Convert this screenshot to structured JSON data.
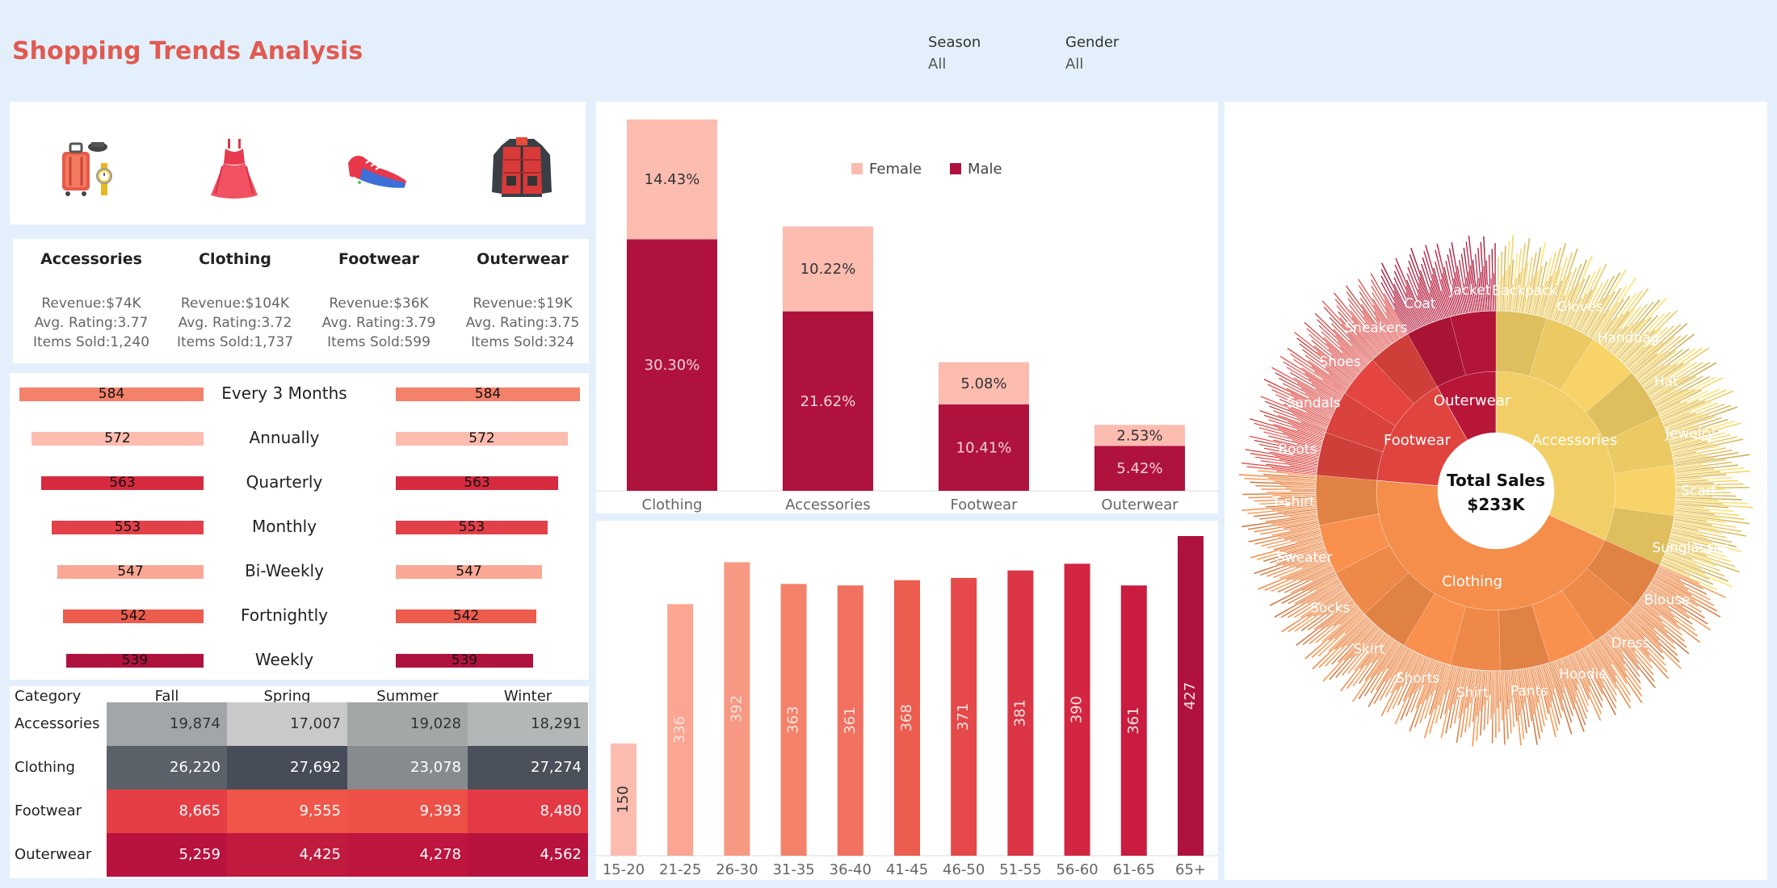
{
  "header": {
    "title": "Shopping Trends Analysis",
    "filters": [
      {
        "label": "Season",
        "value": "All"
      },
      {
        "label": "Gender",
        "value": "All"
      }
    ]
  },
  "icons": [
    "luggage-watch-icon",
    "dress-icon",
    "sneaker-icon",
    "jacket-icon"
  ],
  "categories": [
    {
      "name": "Accessories",
      "revenue": "Revenue:$74K",
      "rating": "Avg. Rating:3.77",
      "items": "Items Sold:1,240"
    },
    {
      "name": "Clothing",
      "revenue": "Revenue:$104K",
      "rating": "Avg. Rating:3.72",
      "items": "Items Sold:1,737"
    },
    {
      "name": "Footwear",
      "revenue": "Revenue:$36K",
      "rating": "Avg. Rating:3.79",
      "items": "Items Sold:599"
    },
    {
      "name": "Outerwear",
      "revenue": "Revenue:$19K",
      "rating": "Avg. Rating:3.75",
      "items": "Items Sold:324"
    }
  ],
  "frequency": {
    "rows": [
      {
        "label": "Every 3 Months",
        "left": "584",
        "right": "584",
        "value": 584,
        "color": "#f4826a"
      },
      {
        "label": "Annually",
        "left": "572",
        "right": "572",
        "value": 572,
        "color": "#fcbcb0"
      },
      {
        "label": "Quarterly",
        "left": "563",
        "right": "563",
        "value": 563,
        "color": "#d62a3f"
      },
      {
        "label": "Monthly",
        "left": "553",
        "right": "553",
        "value": 553,
        "color": "#e2414a"
      },
      {
        "label": "Bi-Weekly",
        "left": "547",
        "right": "547",
        "value": 547,
        "color": "#f9a896"
      },
      {
        "label": "Fortnightly",
        "left": "542",
        "right": "542",
        "value": 542,
        "color": "#ec5c4f"
      },
      {
        "label": "Weekly",
        "left": "539",
        "right": "539",
        "value": 539,
        "color": "#b0123e"
      }
    ]
  },
  "season_table": {
    "corner": "Category",
    "columns": [
      "Fall",
      "Spring",
      "Summer",
      "Winter"
    ],
    "rows": [
      {
        "label": "Accessories",
        "cells": [
          "19,874",
          "17,007",
          "19,028",
          "18,291"
        ],
        "colors": [
          "#a2a6a8",
          "#c8c9c9",
          "#a3a7a8",
          "#b4b7b8"
        ],
        "text": "#333333"
      },
      {
        "label": "Clothing",
        "cells": [
          "26,220",
          "27,692",
          "23,078",
          "27,274"
        ],
        "colors": [
          "#5a6169",
          "#474d58",
          "#868c8e",
          "#4b515b"
        ],
        "text": "#ffffff"
      },
      {
        "label": "Footwear",
        "cells": [
          "8,665",
          "9,555",
          "9,393",
          "8,480"
        ],
        "colors": [
          "#e53f45",
          "#ef5548",
          "#ed5046",
          "#e33a45"
        ],
        "text": "#ffffff"
      },
      {
        "label": "Outerwear",
        "cells": [
          "5,259",
          "4,425",
          "4,278",
          "4,562"
        ],
        "colors": [
          "#b8123e",
          "#c01a3f",
          "#bd153e",
          "#b8133e"
        ],
        "text": "#ffffff"
      }
    ]
  },
  "chart_data": [
    {
      "type": "bar",
      "stacked": true,
      "categories": [
        "Clothing",
        "Accessories",
        "Footwear",
        "Outerwear"
      ],
      "series": [
        {
          "name": "Male",
          "values": [
            30.3,
            21.62,
            10.41,
            5.42
          ],
          "labels": [
            "30.30%",
            "21.62%",
            "10.41%",
            "5.42%"
          ],
          "color": "#b0123e"
        },
        {
          "name": "Female",
          "values": [
            14.43,
            10.22,
            5.08,
            2.53
          ],
          "labels": [
            "14.43%",
            "10.22%",
            "5.08%",
            "2.53%"
          ],
          "color": "#fcbcb0"
        }
      ],
      "legend_order": [
        "Female",
        "Male"
      ],
      "legend_position": "top-right",
      "ylim": [
        0,
        45
      ]
    },
    {
      "type": "bar",
      "categories": [
        "15-20",
        "21-25",
        "26-30",
        "31-35",
        "36-40",
        "41-45",
        "46-50",
        "51-55",
        "56-60",
        "61-65",
        "65+"
      ],
      "values": [
        150,
        336,
        392,
        363,
        361,
        368,
        371,
        381,
        390,
        361,
        427
      ],
      "labels": [
        "150",
        "336",
        "392",
        "363",
        "361",
        "368",
        "371",
        "381",
        "390",
        "361",
        "427"
      ],
      "colors": [
        "#fcbcb0",
        "#fba592",
        "#f79882",
        "#f4826a",
        "#f07160",
        "#ec5c4f",
        "#e54949",
        "#dc3546",
        "#d32642",
        "#c91c40",
        "#b0123e"
      ],
      "ylim": [
        0,
        440
      ]
    },
    {
      "type": "sunburst",
      "center_label": "Total Sales",
      "center_value": "$233K",
      "inner": [
        {
          "name": "Accessories",
          "value": 74,
          "color": "#f2cf66"
        },
        {
          "name": "Clothing",
          "value": 104,
          "color": "#f58d4b"
        },
        {
          "name": "Footwear",
          "value": 36,
          "color": "#e0443f"
        },
        {
          "name": "Outerwear",
          "value": 19,
          "color": "#b81639"
        }
      ],
      "items": [
        {
          "name": "Backpack",
          "group": "Accessories"
        },
        {
          "name": "Gloves",
          "group": "Accessories"
        },
        {
          "name": "Handbag",
          "group": "Accessories"
        },
        {
          "name": "Hat",
          "group": "Accessories"
        },
        {
          "name": "Jewelry",
          "group": "Accessories"
        },
        {
          "name": "Scarf",
          "group": "Accessories"
        },
        {
          "name": "Sunglasses",
          "group": "Accessories"
        },
        {
          "name": "Blouse",
          "group": "Clothing"
        },
        {
          "name": "Dress",
          "group": "Clothing"
        },
        {
          "name": "Hoodie",
          "group": "Clothing"
        },
        {
          "name": "Pants",
          "group": "Clothing"
        },
        {
          "name": "Shirt",
          "group": "Clothing"
        },
        {
          "name": "Shorts",
          "group": "Clothing"
        },
        {
          "name": "Skirt",
          "group": "Clothing"
        },
        {
          "name": "Socks",
          "group": "Clothing"
        },
        {
          "name": "Sweater",
          "group": "Clothing"
        },
        {
          "name": "T-shirt",
          "group": "Clothing"
        },
        {
          "name": "Boots",
          "group": "Footwear"
        },
        {
          "name": "Sandals",
          "group": "Footwear"
        },
        {
          "name": "Shoes",
          "group": "Footwear"
        },
        {
          "name": "Sneakers",
          "group": "Footwear"
        },
        {
          "name": "Coat",
          "group": "Outerwear"
        },
        {
          "name": "Jacket",
          "group": "Outerwear"
        }
      ]
    }
  ]
}
